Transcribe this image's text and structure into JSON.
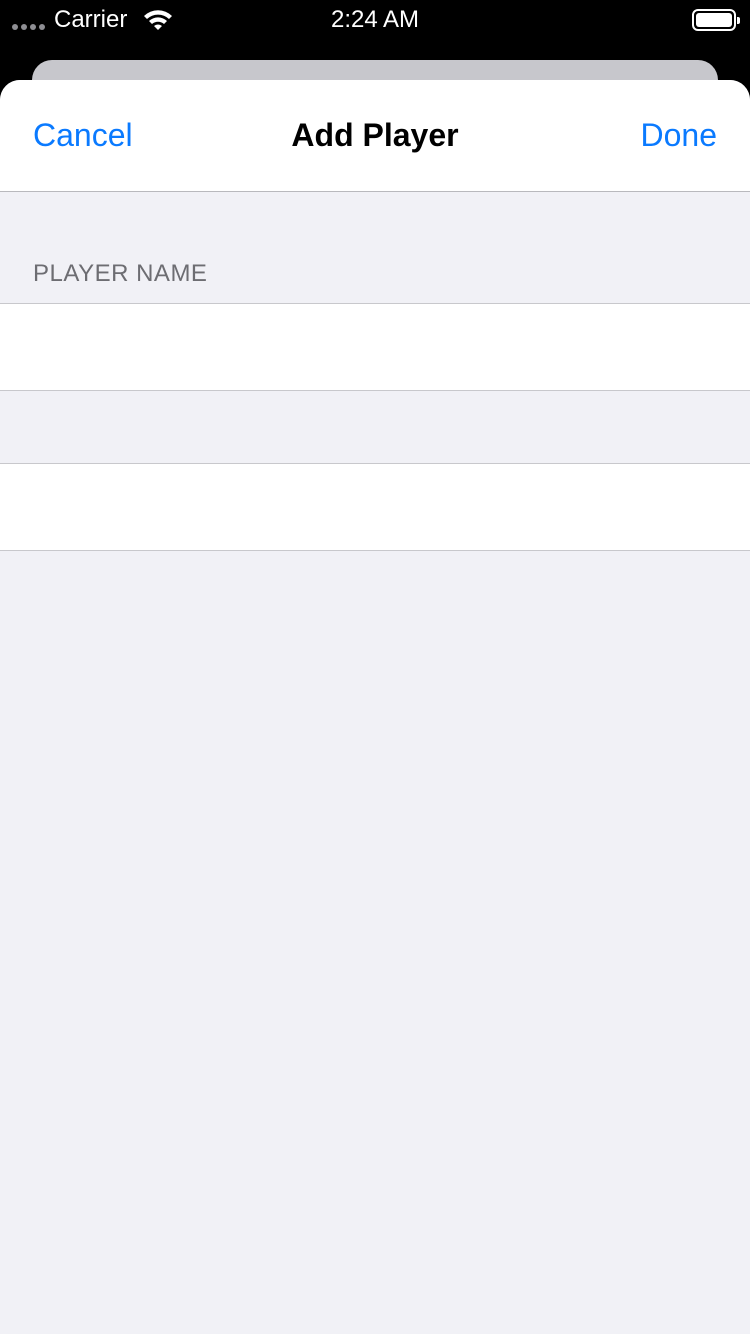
{
  "status_bar": {
    "carrier": "Carrier",
    "time": "2:24 AM",
    "signal_icon": "signal-dots-icon",
    "wifi_icon": "wifi-icon",
    "battery_icon": "battery-icon",
    "battery_level": 1.0
  },
  "nav": {
    "cancel_label": "Cancel",
    "title": "Add Player",
    "done_label": "Done"
  },
  "form": {
    "section_header": "PLAYER NAME",
    "name_value": "",
    "second_value": ""
  },
  "colors": {
    "accent": "#0a7aff",
    "background": "#f1f1f6",
    "section_header": "#6d6d72"
  }
}
